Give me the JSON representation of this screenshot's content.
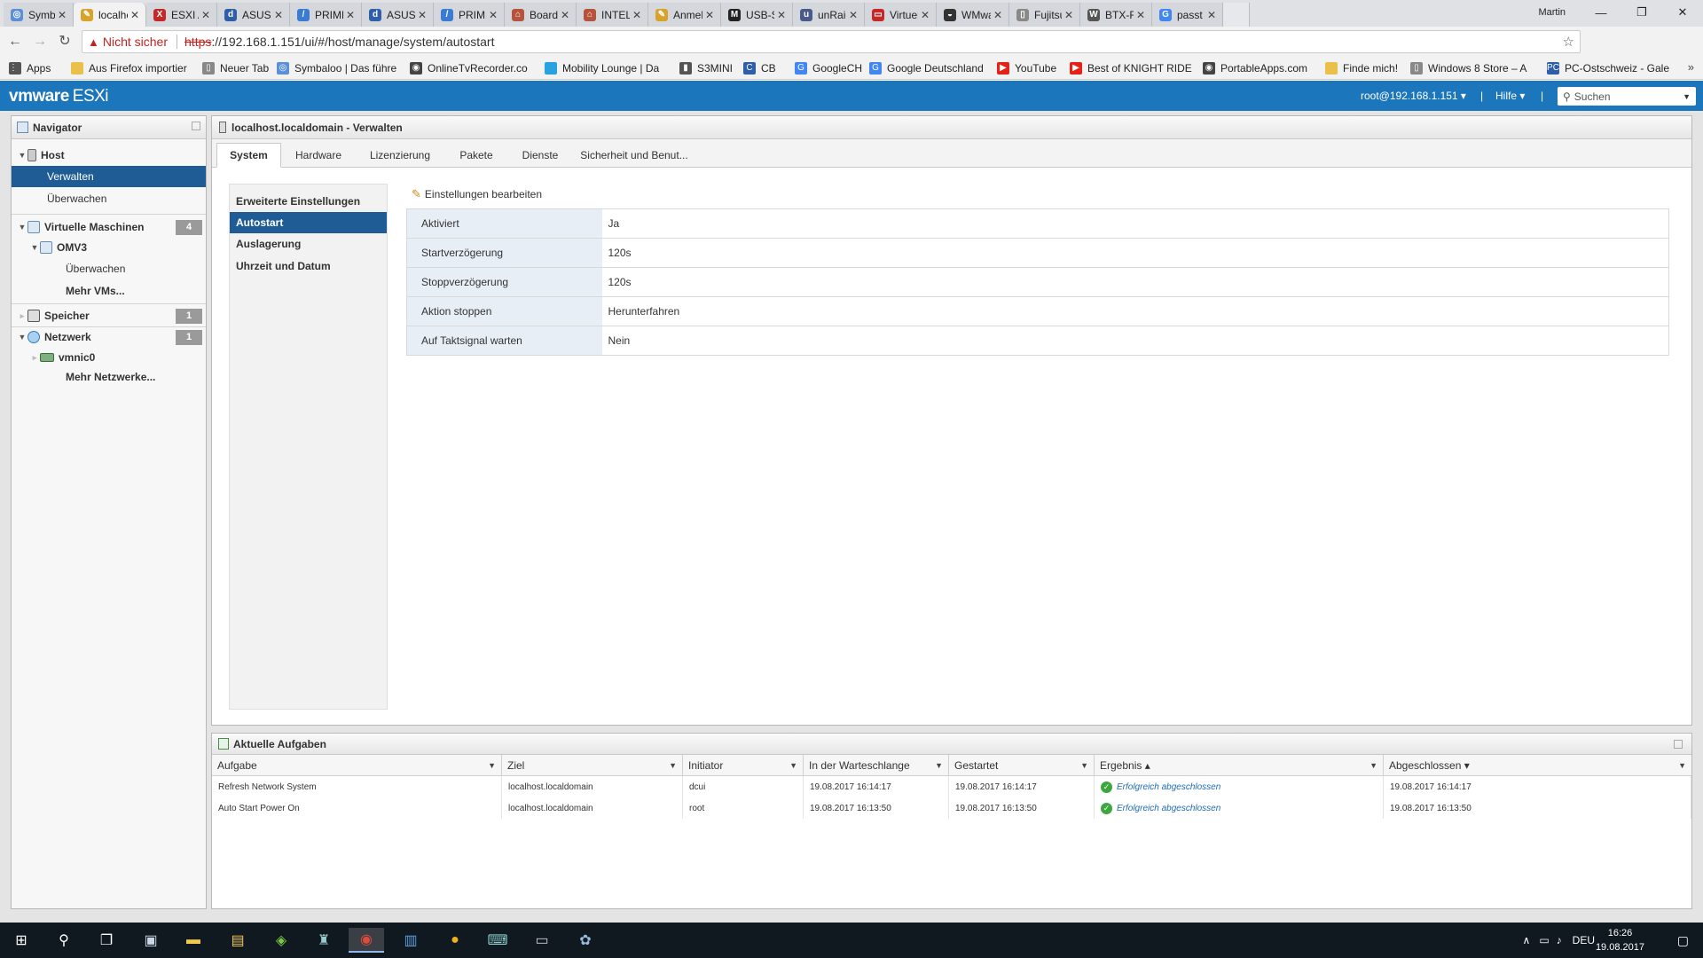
{
  "browser": {
    "tabs": [
      {
        "title": "Symba",
        "color": "#5b8fd6",
        "glyph": "◎"
      },
      {
        "title": "localhc",
        "color": "#d8a22b",
        "glyph": "✎"
      },
      {
        "title": "ESXI A",
        "color": "#c62828",
        "glyph": "X"
      },
      {
        "title": "ASUS F",
        "color": "#2f5fa8",
        "glyph": "d"
      },
      {
        "title": "PRIME",
        "color": "#3a7bd5",
        "glyph": "/"
      },
      {
        "title": "ASUS F",
        "color": "#2f5fa8",
        "glyph": "d"
      },
      {
        "title": "PRIME",
        "color": "#3a7bd5",
        "glyph": "/"
      },
      {
        "title": "Board",
        "color": "#b5533c",
        "glyph": "⌂"
      },
      {
        "title": "INTEL",
        "color": "#b5533c",
        "glyph": "⌂"
      },
      {
        "title": "Anmel",
        "color": "#d8a22b",
        "glyph": "✎"
      },
      {
        "title": "USB-St",
        "color": "#222222",
        "glyph": "M"
      },
      {
        "title": "unRaid",
        "color": "#4a5a8a",
        "glyph": "u"
      },
      {
        "title": "Virtuel",
        "color": "#c62828",
        "glyph": "▭"
      },
      {
        "title": "WMwa",
        "color": "#333333",
        "glyph": "◒"
      },
      {
        "title": "Fujitsu",
        "color": "#888888",
        "glyph": "▯"
      },
      {
        "title": "BTX-Fo",
        "color": "#555555",
        "glyph": "W"
      },
      {
        "title": "passt a",
        "color": "#4285f4",
        "glyph": "G"
      }
    ],
    "profile": "Martin",
    "address_warning": "Nicht sicher",
    "url_scheme": "https",
    "url_rest": "://192.168.1.151/ui/#/host/manage/system/autostart",
    "bookmarks": [
      {
        "label": "Apps",
        "color": "#555555",
        "glyph": "⋮⋮"
      },
      {
        "label": "Aus Firefox importier",
        "color": "#e8c04a",
        "glyph": ""
      },
      {
        "label": "Neuer Tab",
        "color": "#888888",
        "glyph": "▯"
      },
      {
        "label": "Symbaloo | Das führe",
        "color": "#5b8fd6",
        "glyph": "◎"
      },
      {
        "label": "OnlineTvRecorder.co",
        "color": "#444444",
        "glyph": "◉"
      },
      {
        "label": "Mobility Lounge | Da",
        "color": "#2aa1e0",
        "glyph": ""
      },
      {
        "label": "S3MINI",
        "color": "#555555",
        "glyph": "▮"
      },
      {
        "label": "CB",
        "color": "#2f5fa8",
        "glyph": "C"
      },
      {
        "label": "GoogleCH",
        "color": "#4285f4",
        "glyph": "G"
      },
      {
        "label": "Google Deutschland",
        "color": "#4285f4",
        "glyph": "G"
      },
      {
        "label": "YouTube",
        "color": "#e62117",
        "glyph": "▶"
      },
      {
        "label": "Best of KNIGHT RIDE",
        "color": "#e62117",
        "glyph": "▶"
      },
      {
        "label": "PortableApps.com",
        "color": "#444444",
        "glyph": "◉"
      },
      {
        "label": "Finde mich!",
        "color": "#e8c04a",
        "glyph": ""
      },
      {
        "label": "Windows 8 Store – A",
        "color": "#888888",
        "glyph": "▯"
      },
      {
        "label": "PC-Ostschweiz - Gale",
        "color": "#2f5fa8",
        "glyph": "PC"
      }
    ]
  },
  "esxi": {
    "brand": "vmware",
    "product": "ESXi",
    "user": "root@192.168.1.151 ▾",
    "help": "Hilfe ▾",
    "separator": "|",
    "search_placeholder": "Suchen"
  },
  "navigator": {
    "title": "Navigator",
    "items": [
      {
        "label": "Host",
        "badge": ""
      },
      {
        "label": "Verwalten",
        "badge": ""
      },
      {
        "label": "Überwachen",
        "badge": ""
      },
      {
        "label": "Virtuelle Maschinen",
        "badge": "4"
      },
      {
        "label": "OMV3",
        "badge": ""
      },
      {
        "label": "Überwachen",
        "badge": ""
      },
      {
        "label": "Mehr VMs...",
        "badge": ""
      },
      {
        "label": "Speicher",
        "badge": "1"
      },
      {
        "label": "Netzwerk",
        "badge": "1"
      },
      {
        "label": "vmnic0",
        "badge": ""
      },
      {
        "label": "Mehr Netzwerke...",
        "badge": ""
      }
    ]
  },
  "panel": {
    "title": "localhost.localdomain - Verwalten",
    "tabs": [
      "System",
      "Hardware",
      "Lizenzierung",
      "Pakete",
      "Dienste",
      "Sicherheit und Benut..."
    ],
    "subnav": [
      "Erweiterte Einstellungen",
      "Autostart",
      "Auslagerung",
      "Uhrzeit und Datum"
    ],
    "edit_label": "Einstellungen bearbeiten",
    "properties": [
      {
        "key": "Aktiviert",
        "value": "Ja"
      },
      {
        "key": "Startverzögerung",
        "value": "120s"
      },
      {
        "key": "Stoppverzögerung",
        "value": "120s"
      },
      {
        "key": "Aktion stoppen",
        "value": "Herunterfahren"
      },
      {
        "key": "Auf Taktsignal warten",
        "value": "Nein"
      }
    ]
  },
  "tasks": {
    "title": "Aktuelle Aufgaben",
    "columns": [
      "Aufgabe",
      "Ziel",
      "Initiator",
      "In der Warteschlange",
      "Gestartet",
      "Ergebnis ▴",
      "Abgeschlossen ▾"
    ],
    "rows": [
      {
        "task": "Refresh Network System",
        "target": "localhost.localdomain",
        "initiator": "dcui",
        "queued": "19.08.2017 16:14:17",
        "started": "19.08.2017 16:14:17",
        "result": "Erfolgreich abgeschlossen",
        "completed": "19.08.2017 16:14:17"
      },
      {
        "task": "Auto Start Power On",
        "target": "localhost.localdomain",
        "initiator": "root",
        "queued": "19.08.2017 16:13:50",
        "started": "19.08.2017 16:13:50",
        "result": "Erfolgreich abgeschlossen",
        "completed": "19.08.2017 16:13:50"
      }
    ]
  },
  "taskbar": {
    "language": "DEU",
    "time": "16:26",
    "date": "19.08.2017"
  }
}
